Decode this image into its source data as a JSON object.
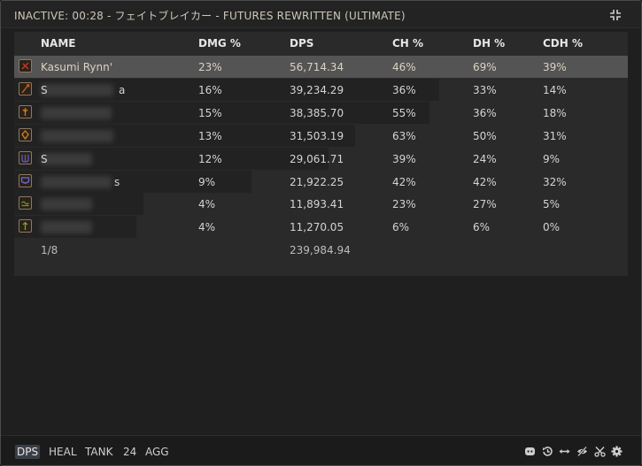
{
  "window": {
    "title": "INACTIVE: 00:28 - フェイトブレイカー - FUTURES REWRITTEN (ULTIMATE)"
  },
  "columns": [
    "NAME",
    "DMG %",
    "DPS",
    "CH %",
    "DH %",
    "CDH %"
  ],
  "rows": [
    {
      "name": "Kasumi Rynn'",
      "name_prefix": "",
      "name_suffix": "",
      "dmg": "23%",
      "dps": "56,714.34",
      "ch": "46%",
      "dh": "69%",
      "cdh": "39%",
      "share": 1.0,
      "job": "viper",
      "job_color": "#c0392b"
    },
    {
      "name": "",
      "name_prefix": "S",
      "name_suffix": "a",
      "dmg": "16%",
      "dps": "39,234.29",
      "ch": "36%",
      "dh": "33%",
      "cdh": "14%",
      "share": 0.692,
      "job": "dragoon",
      "job_color": "#c2612a"
    },
    {
      "name": "",
      "name_prefix": "",
      "name_suffix": "",
      "dmg": "15%",
      "dps": "38,385.70",
      "ch": "55%",
      "dh": "36%",
      "cdh": "18%",
      "share": 0.677,
      "job": "bard",
      "job_color": "#c27a2a"
    },
    {
      "name": "",
      "name_prefix": "",
      "name_suffix": "",
      "dmg": "13%",
      "dps": "31,503.19",
      "ch": "63%",
      "dh": "50%",
      "cdh": "31%",
      "share": 0.556,
      "job": "monk",
      "job_color": "#c4872d"
    },
    {
      "name": "",
      "name_prefix": "S",
      "name_suffix": "",
      "dmg": "12%",
      "dps": "29,061.71",
      "ch": "39%",
      "dh": "24%",
      "cdh": "9%",
      "share": 0.512,
      "job": "reaper",
      "job_color": "#5b5fc7"
    },
    {
      "name": "",
      "name_prefix": "",
      "name_suffix": "s",
      "dmg": "9%",
      "dps": "21,922.25",
      "ch": "42%",
      "dh": "42%",
      "cdh": "32%",
      "share": 0.387,
      "job": "paladin",
      "job_color": "#6b6fd6"
    },
    {
      "name": "",
      "name_prefix": "",
      "name_suffix": "",
      "dmg": "4%",
      "dps": "11,893.41",
      "ch": "23%",
      "dh": "27%",
      "cdh": "5%",
      "share": 0.21,
      "job": "scholar",
      "job_color": "#6b9a2a"
    },
    {
      "name": "",
      "name_prefix": "",
      "name_suffix": "",
      "dmg": "4%",
      "dps": "11,270.05",
      "ch": "6%",
      "dh": "6%",
      "cdh": "0%",
      "share": 0.199,
      "job": "white-mage",
      "job_color": "#7ba52c"
    }
  ],
  "total": {
    "count": "1/8",
    "dps": "239,984.94"
  },
  "bottom_tabs": [
    {
      "label": "DPS",
      "active": true
    },
    {
      "label": "HEAL",
      "active": false
    },
    {
      "label": "TANK",
      "active": false
    },
    {
      "label": "24",
      "active": false
    },
    {
      "label": "AGG",
      "active": false
    }
  ],
  "bottom_icons": [
    "discord-icon",
    "history-icon",
    "resize-horizontal-icon",
    "hide-icon",
    "close-encounter-icon",
    "settings-icon"
  ]
}
